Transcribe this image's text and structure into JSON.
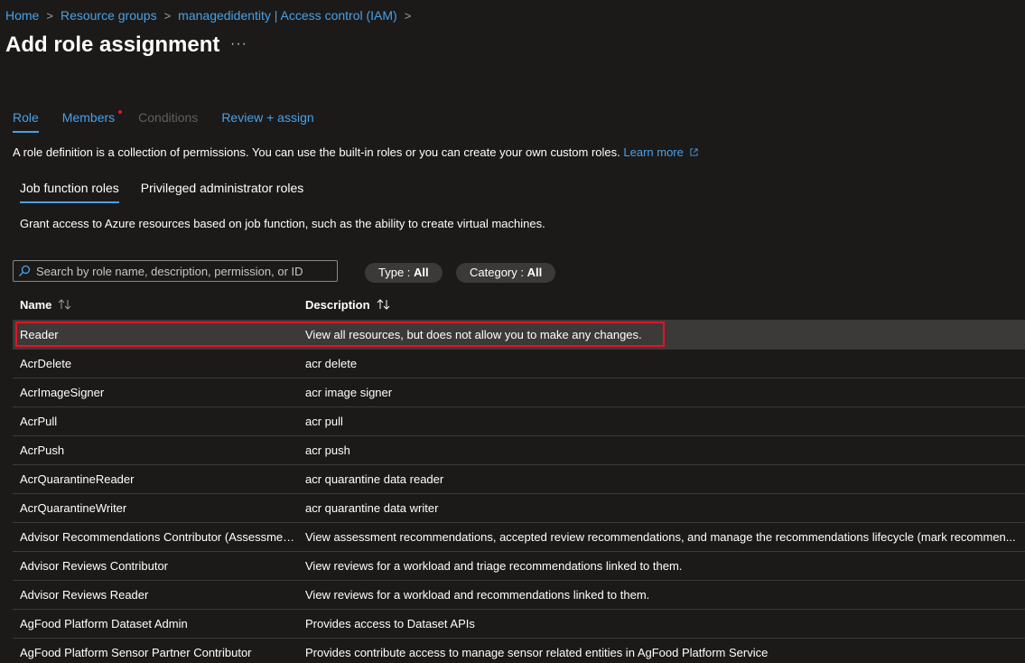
{
  "breadcrumb": {
    "items": [
      "Home",
      "Resource groups",
      "managedidentity | Access control (IAM)"
    ],
    "separator": ">"
  },
  "page": {
    "title": "Add role assignment",
    "more_label": "···"
  },
  "wizard_tabs": [
    {
      "label": "Role",
      "state": "active"
    },
    {
      "label": "Members",
      "state": "link",
      "required": true
    },
    {
      "label": "Conditions",
      "state": "disabled"
    },
    {
      "label": "Review + assign",
      "state": "link"
    }
  ],
  "intro": {
    "text": "A role definition is a collection of permissions. You can use the built-in roles or you can create your own custom roles.",
    "learn_more": "Learn more"
  },
  "sub_tabs": [
    {
      "label": "Job function roles",
      "active": true
    },
    {
      "label": "Privileged administrator roles",
      "active": false
    }
  ],
  "sub_description": "Grant access to Azure resources based on job function, such as the ability to create virtual machines.",
  "search": {
    "placeholder": "Search by role name, description, permission, or ID",
    "value": ""
  },
  "filters": {
    "type": {
      "label": "Type :",
      "value": "All"
    },
    "category": {
      "label": "Category :",
      "value": "All"
    }
  },
  "table": {
    "columns": [
      "Name",
      "Description"
    ],
    "selected_row": 0,
    "rows": [
      {
        "name": "Reader",
        "description": "View all resources, but does not allow you to make any changes."
      },
      {
        "name": "AcrDelete",
        "description": "acr delete"
      },
      {
        "name": "AcrImageSigner",
        "description": "acr image signer"
      },
      {
        "name": "AcrPull",
        "description": "acr pull"
      },
      {
        "name": "AcrPush",
        "description": "acr push"
      },
      {
        "name": "AcrQuarantineReader",
        "description": "acr quarantine data reader"
      },
      {
        "name": "AcrQuarantineWriter",
        "description": "acr quarantine data writer"
      },
      {
        "name": "Advisor Recommendations Contributor (Assessment...",
        "description": "View assessment recommendations, accepted review recommendations, and manage the recommendations lifecycle (mark recommen..."
      },
      {
        "name": "Advisor Reviews Contributor",
        "description": "View reviews for a workload and triage recommendations linked to them."
      },
      {
        "name": "Advisor Reviews Reader",
        "description": "View reviews for a workload and recommendations linked to them."
      },
      {
        "name": "AgFood Platform Dataset Admin",
        "description": "Provides access to Dataset APIs"
      },
      {
        "name": "AgFood Platform Sensor Partner Contributor",
        "description": "Provides contribute access to manage sensor related entities in AgFood Platform Service"
      }
    ]
  },
  "colors": {
    "background": "#1b1a19",
    "accent": "#4aa0e6",
    "selected_row": "#3b3a39",
    "highlight": "#e81123",
    "required_dot": "#e81123"
  },
  "icons": {
    "search": "search-icon",
    "sort": "sort-arrows-icon",
    "external_link": "external-link-icon",
    "breadcrumb_separator": "chevron-right-icon"
  }
}
